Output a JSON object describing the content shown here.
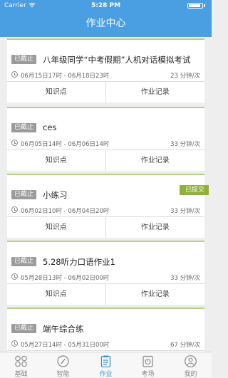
{
  "status_bar": {
    "carrier": "Carrier",
    "time": "5:28 PM"
  },
  "nav": {
    "title": "作业中心"
  },
  "cards": [
    {
      "badge": "已截止",
      "title": "八年级同学“中考假期”人机对话模拟考试",
      "submitted": "",
      "date": "06月15日17时 - 06月18日23时",
      "duration": "23 分钟/次",
      "left_action": "知识点",
      "right_action": "作业记录"
    },
    {
      "badge": "已截止",
      "title": "ces",
      "submitted": "",
      "date": "06月05日14时 - 06月06日14时",
      "duration": "33 分钟/次",
      "left_action": "知识点",
      "right_action": "作业记录"
    },
    {
      "badge": "已截止",
      "title": "小练习",
      "submitted": "已提交",
      "date": "06月02日10时 - 06月04日20时",
      "duration": "33 分钟/次",
      "left_action": "知识点",
      "right_action": "作业记录"
    },
    {
      "badge": "已截止",
      "title": "5.28听力口语作业1",
      "submitted": "",
      "date": "05月28日13时 - 06月02日00时",
      "duration": "33 分钟/次",
      "left_action": "知识点",
      "right_action": "作业记录"
    },
    {
      "badge": "已截止",
      "title": "端午综合练",
      "submitted": "",
      "date": "05月27日14时 - 05月31日00时",
      "duration": "67 分钟/次",
      "left_action": "知识点",
      "right_action": "作业记录"
    }
  ],
  "tabs": [
    {
      "label": "基础",
      "icon": "grid-icon",
      "active": false
    },
    {
      "label": "智能",
      "icon": "compass-icon",
      "active": false
    },
    {
      "label": "作业",
      "icon": "clipboard-icon",
      "active": true
    },
    {
      "label": "考场",
      "icon": "exam-icon",
      "active": false
    },
    {
      "label": "我的",
      "icon": "user-icon",
      "active": false
    }
  ],
  "colors": {
    "header": "#4a9ee2",
    "card_border": "#b5cf86",
    "badge": "#9b9b9b",
    "submitted": "#8fb13b",
    "tab_active": "#3d8fd6"
  }
}
